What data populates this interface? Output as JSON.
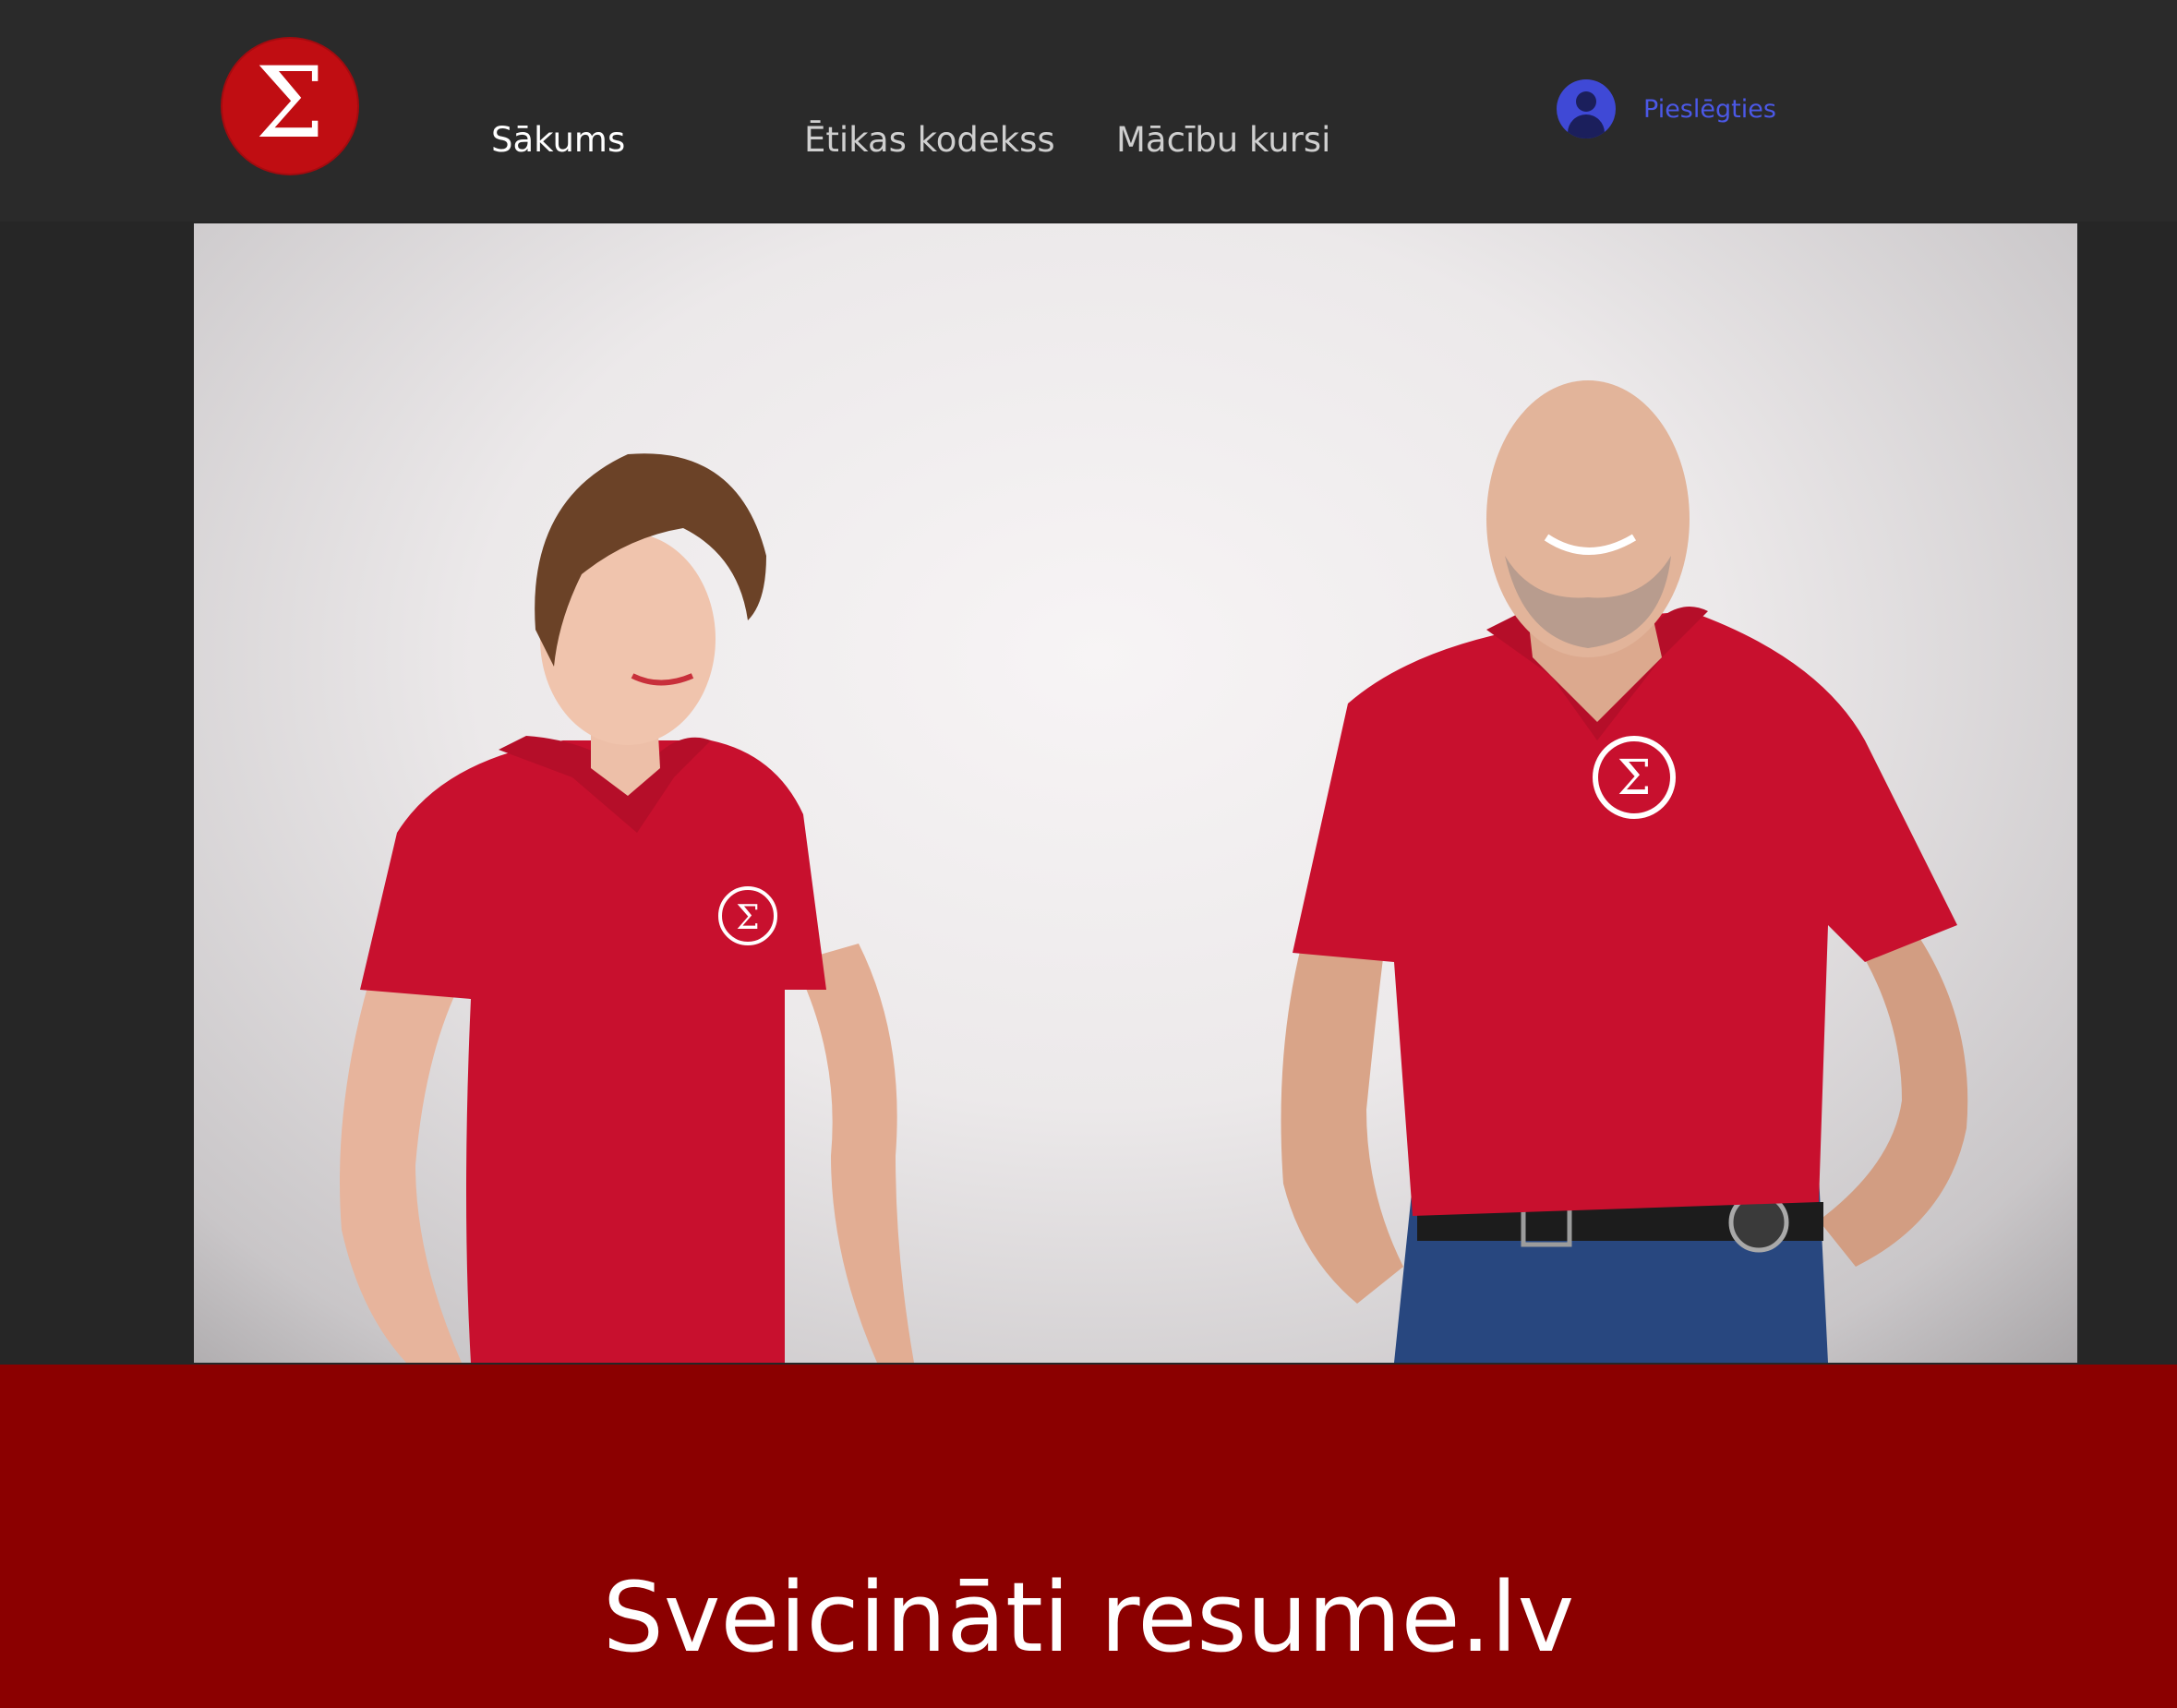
{
  "logo": {
    "glyph": "Σ",
    "color": "#c00d12"
  },
  "nav": {
    "home": "Sākums",
    "ethics": "Ētikas kodekss",
    "courses": "Mācību kursi"
  },
  "login": {
    "label": "Pieslēgties",
    "icon": "account-icon",
    "color": "#3f49d6"
  },
  "hero": {
    "image": "photo-two-people-red-polo-shirts"
  },
  "banner": {
    "title": "Sveicināti resume.lv",
    "color": "#8b0000"
  }
}
